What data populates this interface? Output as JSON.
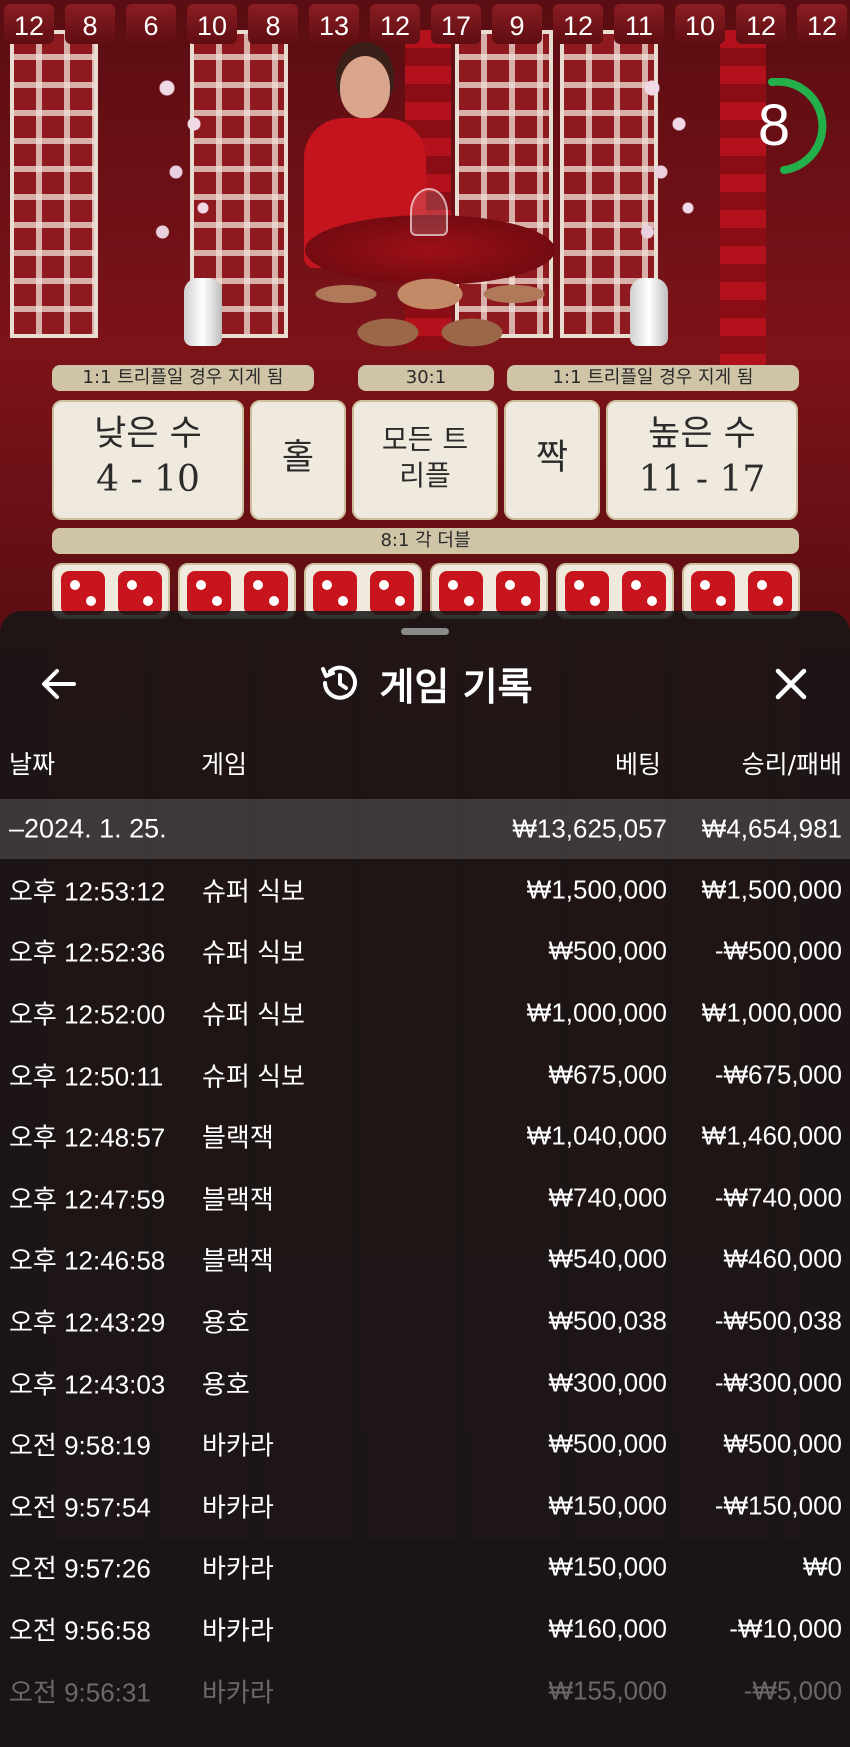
{
  "game": {
    "history_numbers": [
      "12",
      "8",
      "6",
      "10",
      "8",
      "13",
      "12",
      "17",
      "9",
      "12",
      "11",
      "10",
      "12",
      "12"
    ],
    "timer": "8",
    "board": {
      "strip_left": "1:1 트리플일 경우 지게 됨",
      "strip_mid": "30:1",
      "strip_right": "1:1 트리플일 경우 지게 됨",
      "low_label": "낮은 수",
      "low_range": "4 - 10",
      "odd_label": "홀",
      "any_triple_label": "모든 트리플",
      "even_label": "짝",
      "high_label": "높은 수",
      "high_range": "11 - 17",
      "double_strip": "8:1 각 더블"
    }
  },
  "sheet": {
    "title": "게임 기록",
    "icons": {
      "back": "arrow-left-icon",
      "history": "history-clock-icon",
      "close": "close-x-icon"
    },
    "columns": {
      "date": "날짜",
      "game": "게임",
      "bet": "베팅",
      "winloss": "승리/패배"
    },
    "date_row": {
      "date": "–2024. 1. 25.",
      "bet": "₩13,625,057",
      "winloss": "₩4,654,981"
    },
    "rows": [
      {
        "time": "오후 12:53:12",
        "game": "슈퍼 식보",
        "bet": "₩1,500,000",
        "winloss": "₩1,500,000"
      },
      {
        "time": "오후 12:52:36",
        "game": "슈퍼 식보",
        "bet": "₩500,000",
        "winloss": "-₩500,000"
      },
      {
        "time": "오후 12:52:00",
        "game": "슈퍼 식보",
        "bet": "₩1,000,000",
        "winloss": "₩1,000,000"
      },
      {
        "time": "오후 12:50:11",
        "game": "슈퍼 식보",
        "bet": "₩675,000",
        "winloss": "-₩675,000"
      },
      {
        "time": "오후 12:48:57",
        "game": "블랙잭",
        "bet": "₩1,040,000",
        "winloss": "₩1,460,000"
      },
      {
        "time": "오후 12:47:59",
        "game": "블랙잭",
        "bet": "₩740,000",
        "winloss": "-₩740,000"
      },
      {
        "time": "오후 12:46:58",
        "game": "블랙잭",
        "bet": "₩540,000",
        "winloss": "₩460,000"
      },
      {
        "time": "오후 12:43:29",
        "game": "용호",
        "bet": "₩500,038",
        "winloss": "-₩500,038"
      },
      {
        "time": "오후 12:43:03",
        "game": "용호",
        "bet": "₩300,000",
        "winloss": "-₩300,000"
      },
      {
        "time": "오전 9:58:19",
        "game": "바카라",
        "bet": "₩500,000",
        "winloss": "₩500,000"
      },
      {
        "time": "오전 9:57:54",
        "game": "바카라",
        "bet": "₩150,000",
        "winloss": "-₩150,000"
      },
      {
        "time": "오전 9:57:26",
        "game": "바카라",
        "bet": "₩150,000",
        "winloss": "₩0"
      },
      {
        "time": "오전 9:56:58",
        "game": "바카라",
        "bet": "₩160,000",
        "winloss": "-₩10,000"
      },
      {
        "time": "오전 9:56:31",
        "game": "바카라",
        "bet": "₩155,000",
        "winloss": "-₩5,000"
      }
    ]
  }
}
